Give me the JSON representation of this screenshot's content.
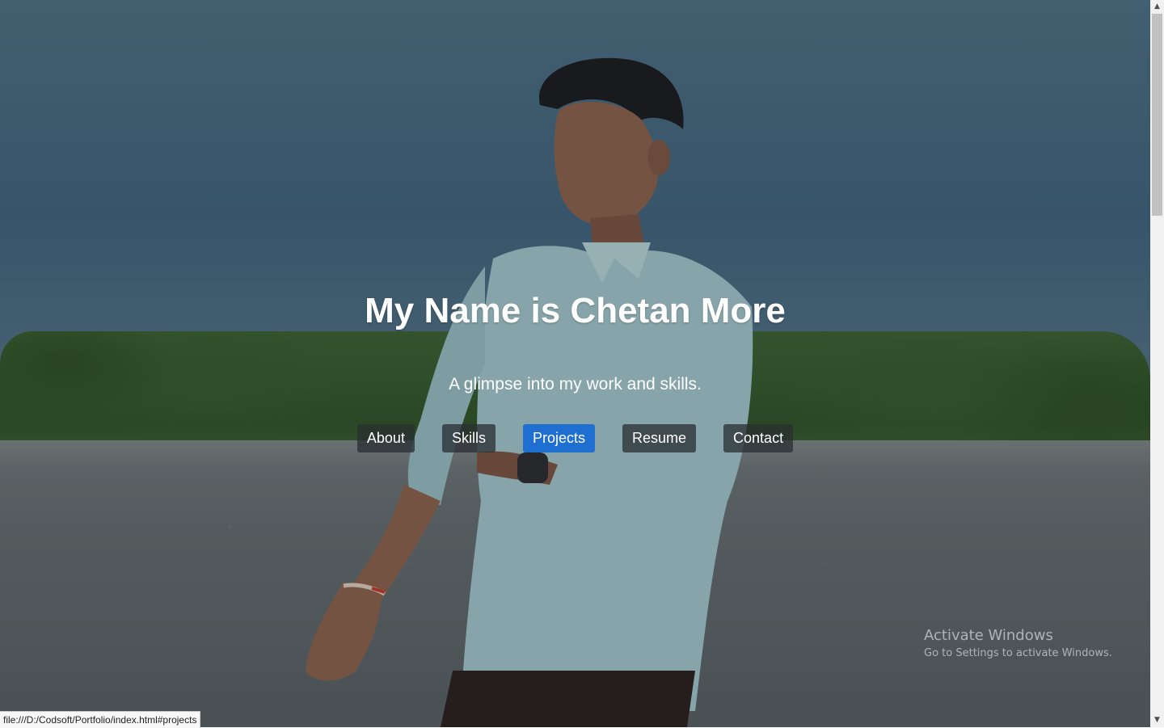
{
  "hero": {
    "title": "My Name is Chetan More",
    "subtitle": "A glimpse into my work and skills."
  },
  "nav": {
    "items": [
      {
        "label": "About",
        "active": false
      },
      {
        "label": "Skills",
        "active": false
      },
      {
        "label": "Projects",
        "active": true
      },
      {
        "label": "Resume",
        "active": false
      },
      {
        "label": "Contact",
        "active": false
      }
    ]
  },
  "watermark": {
    "title": "Activate Windows",
    "subtitle": "Go to Settings to activate Windows."
  },
  "statusbar": {
    "url": "file:///D:/Codsoft/Portfolio/index.html#projects"
  },
  "scrollbar": {
    "up_icon": "chevron-up-icon",
    "down_icon": "chevron-down-icon"
  },
  "colors": {
    "active_button": "#1f6fd1",
    "button_bg": "#2a2f34",
    "text": "#ffffff"
  }
}
